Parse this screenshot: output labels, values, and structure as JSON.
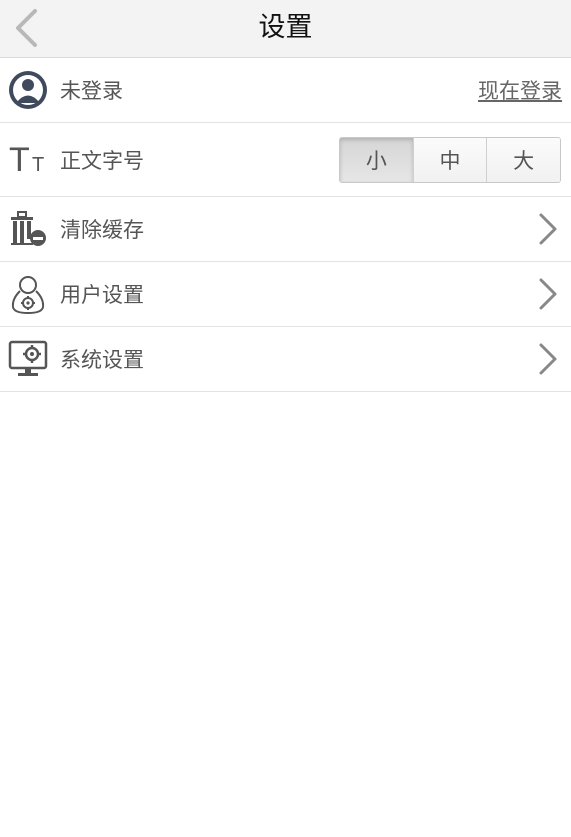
{
  "header": {
    "title": "设置",
    "back_icon": "chevron-left-icon"
  },
  "login": {
    "status": "未登录",
    "action": "现在登录",
    "icon": "user-avatar-icon"
  },
  "font_size": {
    "label": "正文字号",
    "icon": "text-size-icon",
    "options": [
      "小",
      "中",
      "大"
    ],
    "selected": "小"
  },
  "items": [
    {
      "label": "清除缓存",
      "icon": "trash-icon"
    },
    {
      "label": "用户设置",
      "icon": "user-settings-icon"
    },
    {
      "label": "系统设置",
      "icon": "monitor-settings-icon"
    }
  ],
  "colors": {
    "header_bg": "#f3f3f3",
    "icon": "#555555",
    "divider": "#e3e3e3"
  }
}
